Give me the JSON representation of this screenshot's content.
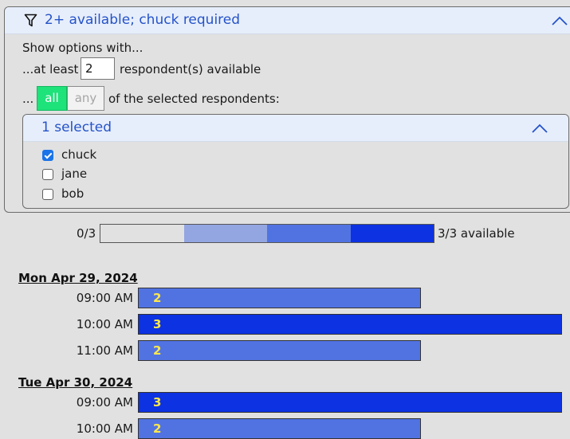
{
  "filter": {
    "title": "2+ available; chuck required",
    "show_options_text": "Show options with...",
    "at_least_prefix": "...at least",
    "at_least_value": "2",
    "at_least_suffix": "respondent(s) available",
    "ellipsis_prefix": "...",
    "mode_all": "all",
    "mode_any": "any",
    "selected_mode": "all",
    "mode_suffix": "of the selected respondents:",
    "respondents": {
      "summary": "1 selected",
      "items": [
        {
          "name": "chuck",
          "checked": true
        },
        {
          "name": "jane",
          "checked": false
        },
        {
          "name": "bob",
          "checked": false
        }
      ]
    }
  },
  "legend": {
    "min_label": "0/3",
    "max_label": "3/3 available",
    "colors": [
      "#e1e1e1",
      "#93a6e2",
      "#5173e2",
      "#0d32e2"
    ]
  },
  "schedule": {
    "max_count": 3,
    "days": [
      {
        "date": "Mon Apr 29, 2024",
        "slots": [
          {
            "time": "09:00 AM",
            "count": 2
          },
          {
            "time": "10:00 AM",
            "count": 3
          },
          {
            "time": "11:00 AM",
            "count": 2
          }
        ]
      },
      {
        "date": "Tue Apr 30, 2024",
        "slots": [
          {
            "time": "09:00 AM",
            "count": 3
          },
          {
            "time": "10:00 AM",
            "count": 2
          }
        ]
      }
    ]
  }
}
